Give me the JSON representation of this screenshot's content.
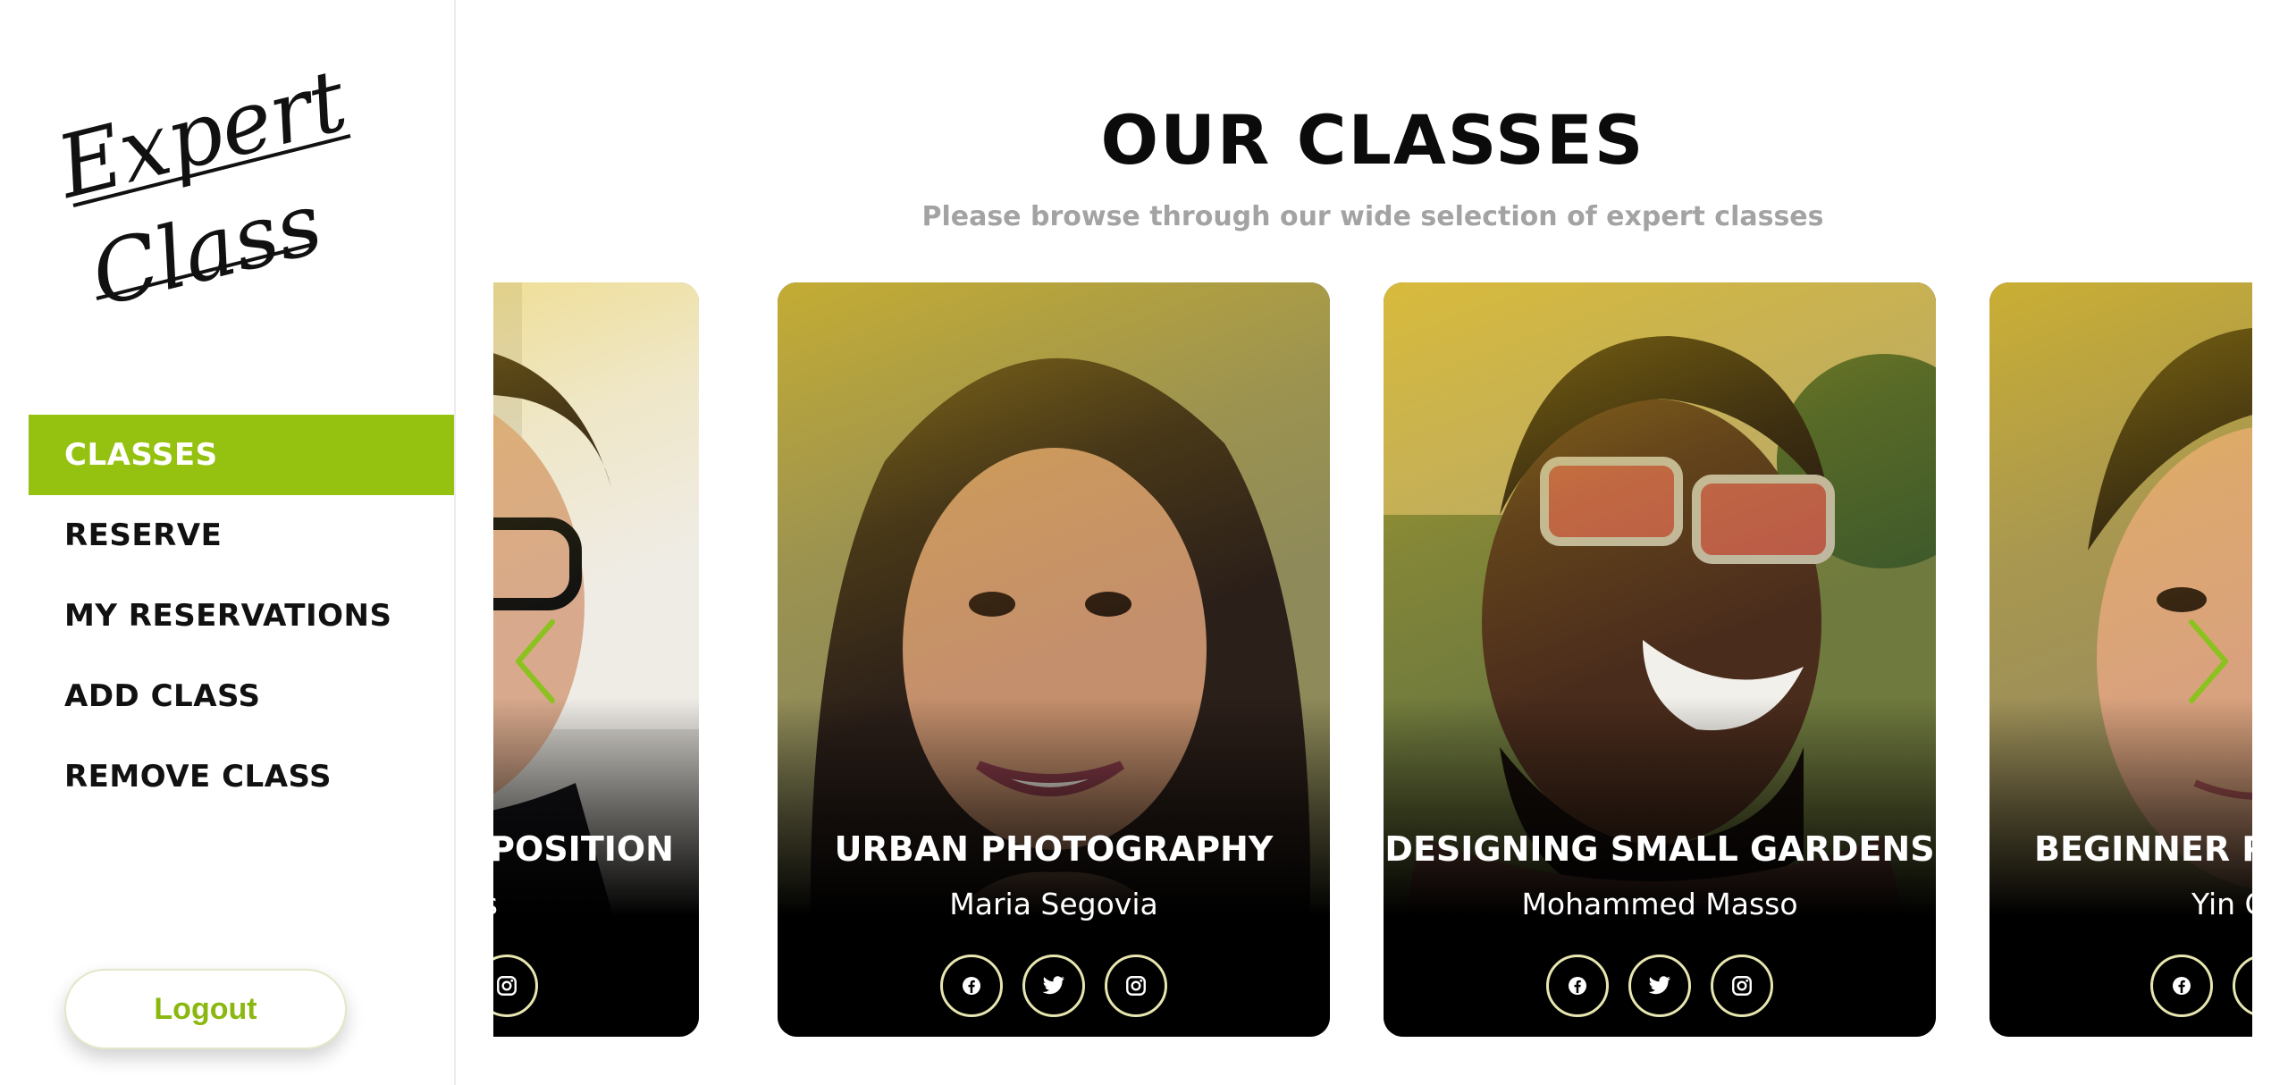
{
  "sidebar": {
    "logo_line1": "Expert",
    "logo_line2": "Class",
    "nav": [
      {
        "label": "CLASSES",
        "active": true
      },
      {
        "label": "RESERVE",
        "active": false
      },
      {
        "label": "MY RESERVATIONS",
        "active": false
      },
      {
        "label": "ADD CLASS",
        "active": false
      },
      {
        "label": "REMOVE CLASS",
        "active": false
      }
    ],
    "logout_label": "Logout"
  },
  "main": {
    "title": "OUR CLASSES",
    "subtitle": "Please browse through our wide selection of expert classes",
    "prev_icon": "chevron-left-icon",
    "next_icon": "chevron-right-icon",
    "accent_color": "#95c211",
    "cards": [
      {
        "title": "MPOSITION",
        "teacher": "ns",
        "icons": [
          "instagram-icon"
        ]
      },
      {
        "title": "URBAN PHOTOGRAPHY",
        "teacher": "Maria Segovia",
        "icons": [
          "facebook-icon",
          "twitter-icon",
          "instagram-icon"
        ]
      },
      {
        "title": "DESIGNING SMALL GARDENS",
        "teacher": "Mohammed Masso",
        "icons": [
          "facebook-icon",
          "twitter-icon",
          "instagram-icon"
        ]
      },
      {
        "title": "BEGINNER PIA",
        "teacher": "Yin C",
        "icons": [
          "facebook-icon",
          "twitter-icon"
        ]
      }
    ]
  }
}
